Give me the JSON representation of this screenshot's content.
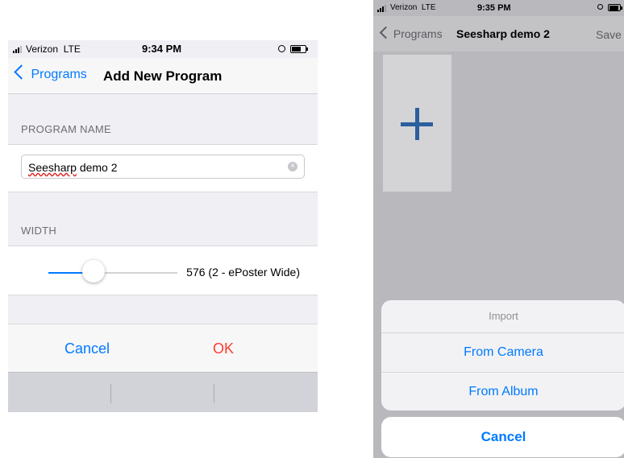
{
  "left_screen": {
    "status": {
      "carrier": "Verizon",
      "network": "LTE",
      "time": "9:34 PM"
    },
    "nav": {
      "back_label": "Programs",
      "title": "Add New Program"
    },
    "program_name": {
      "section_label": "PROGRAM NAME",
      "value_misspelled": "Seesharp",
      "value_rest": " demo 2"
    },
    "width": {
      "section_label": "WIDTH",
      "slider_fraction": 0.35,
      "value_label": "576 (2 - ePoster Wide)"
    },
    "alert": {
      "cancel_label": "Cancel",
      "ok_label": "OK"
    },
    "colors": {
      "accent": "#007aff",
      "destructive": "#ff3b30"
    }
  },
  "right_screen": {
    "status": {
      "carrier": "Verizon",
      "network": "LTE",
      "time": "9:35 PM"
    },
    "nav": {
      "back_label": "Programs",
      "title": "Seesharp demo 2",
      "save_label": "Save"
    },
    "add_tile_icon": "plus-icon",
    "action_sheet": {
      "title": "Import",
      "options": [
        "From Camera",
        "From Album"
      ],
      "cancel_label": "Cancel"
    }
  }
}
